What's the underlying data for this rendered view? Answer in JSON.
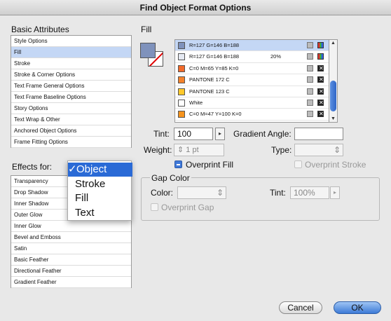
{
  "window": {
    "title": "Find Object Format Options"
  },
  "basic_attributes": {
    "heading": "Basic Attributes",
    "items": [
      {
        "label": "Style Options",
        "selected": false
      },
      {
        "label": "Fill",
        "selected": true
      },
      {
        "label": "Stroke",
        "selected": false
      },
      {
        "label": "Stroke & Corner Options",
        "selected": false
      },
      {
        "label": "Text Frame General Options",
        "selected": false
      },
      {
        "label": "Text Frame Baseline Options",
        "selected": false
      },
      {
        "label": "Story Options",
        "selected": false
      },
      {
        "label": "Text Wrap & Other",
        "selected": false
      },
      {
        "label": "Anchored Object Options",
        "selected": false
      },
      {
        "label": "Frame Fitting Options",
        "selected": false
      }
    ]
  },
  "effects": {
    "label": "Effects for:",
    "popup": {
      "options": [
        "Object",
        "Stroke",
        "Fill",
        "Text"
      ],
      "selected": "Object",
      "check_mark": "✓"
    },
    "items": [
      "Transparency",
      "Drop Shadow",
      "Inner Shadow",
      "Outer Glow",
      "Inner Glow",
      "Bevel and Emboss",
      "Satin",
      "Basic Feather",
      "Directional Feather",
      "Gradient Feather"
    ]
  },
  "fill": {
    "heading": "Fill",
    "swatches": [
      {
        "name": "R=127 G=146 B=188",
        "tint": "",
        "color": "#7f92bc",
        "model": "rgb",
        "selected": true
      },
      {
        "name": "R=127 G=146 B=188",
        "tint": "20%",
        "color": "#e5e9f2",
        "model": "rgb",
        "selected": false
      },
      {
        "name": "C=0 M=65 Y=85 K=0",
        "tint": "",
        "color": "#f26a2a",
        "model": "cmyk",
        "selected": false
      },
      {
        "name": "PANTONE 172 C",
        "tint": "",
        "color": "#f5822a",
        "model": "cmyk",
        "selected": false
      },
      {
        "name": "PANTONE 123 C",
        "tint": "",
        "color": "#ffc82a",
        "model": "cmyk",
        "selected": false
      },
      {
        "name": "White",
        "tint": "",
        "color": "#ffffff",
        "model": "cmyk",
        "selected": false
      },
      {
        "name": "C=0 M=47 Y=100 K=0",
        "tint": "",
        "color": "#f6941d",
        "model": "cmyk",
        "selected": false
      }
    ],
    "tint_label": "Tint:",
    "tint_value": "100",
    "gradient_angle_label": "Gradient Angle:",
    "gradient_angle_value": "",
    "weight_label": "Weight:",
    "weight_value": "1 pt",
    "type_label": "Type:",
    "type_value": "",
    "overprint_fill_label": "Overprint Fill",
    "overprint_stroke_label": "Overprint Stroke"
  },
  "gap_color": {
    "heading": "Gap Color",
    "color_label": "Color:",
    "color_value": "",
    "tint_label": "Tint:",
    "tint_value": "100%",
    "overprint_gap_label": "Overprint Gap"
  },
  "buttons": {
    "cancel": "Cancel",
    "ok": "OK"
  },
  "icons": {
    "arrow_right": "▸",
    "stepper": "⇕",
    "scroll_up": "▲",
    "scroll_down": "▼"
  }
}
